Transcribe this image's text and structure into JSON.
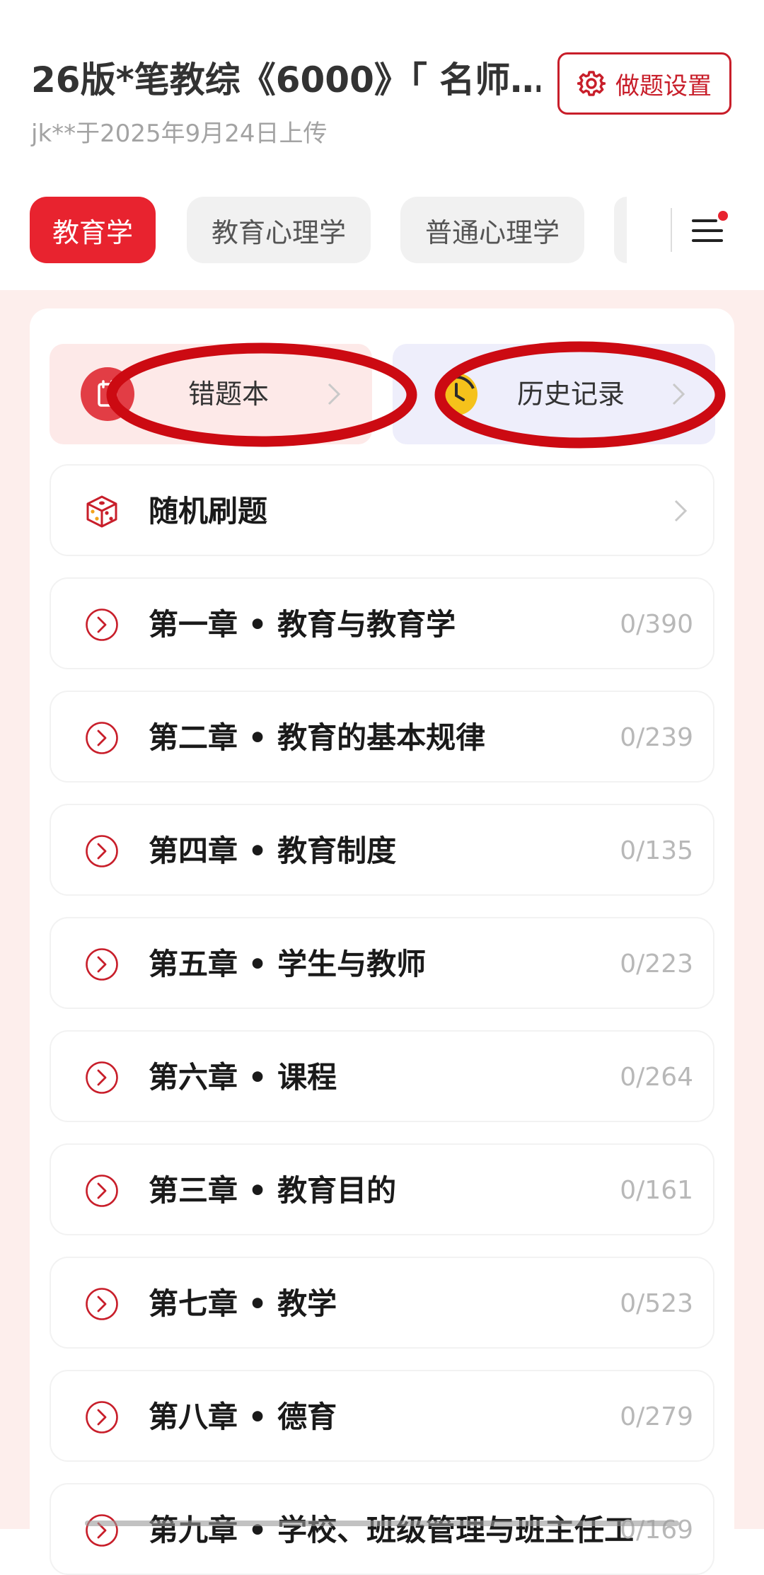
{
  "header": {
    "title": "26版*笔教综《6000》「 名师…",
    "uploader": "jk**于2025年9月24日上传",
    "settings_label": "做题设置"
  },
  "tabs": [
    {
      "label": "教育学",
      "active": true
    },
    {
      "label": "教育心理学",
      "active": false
    },
    {
      "label": "普通心理学",
      "active": false
    }
  ],
  "menu": {
    "icon": "menu-icon",
    "has_notification_dot": true
  },
  "quick_actions": {
    "wrong_book": {
      "label": "错题本",
      "icon": "wrong-book-icon"
    },
    "history": {
      "label": "历史记录",
      "icon": "history-icon"
    }
  },
  "random_practice": {
    "label": "随机刷题",
    "icon": "dice-icon"
  },
  "chapters": [
    {
      "label": "第一章 • 教育与教育学",
      "count": "0/390"
    },
    {
      "label": "第二章 • 教育的基本规律",
      "count": "0/239"
    },
    {
      "label": "第四章 • 教育制度",
      "count": "0/135"
    },
    {
      "label": "第五章 • 学生与教师",
      "count": "0/223"
    },
    {
      "label": "第六章 • 课程",
      "count": "0/264"
    },
    {
      "label": "第三章 • 教育目的",
      "count": "0/161"
    },
    {
      "label": "第七章 • 教学",
      "count": "0/523"
    },
    {
      "label": "第八章 • 德育",
      "count": "0/279"
    },
    {
      "label": "第九章 • 学校、班级管理与班主任工",
      "count": "0/169"
    }
  ],
  "colors": {
    "accent": "#e8232f",
    "accent_dark": "#c81e2a",
    "content_background": "#fdeeec",
    "annotation": "#cc0a12"
  }
}
